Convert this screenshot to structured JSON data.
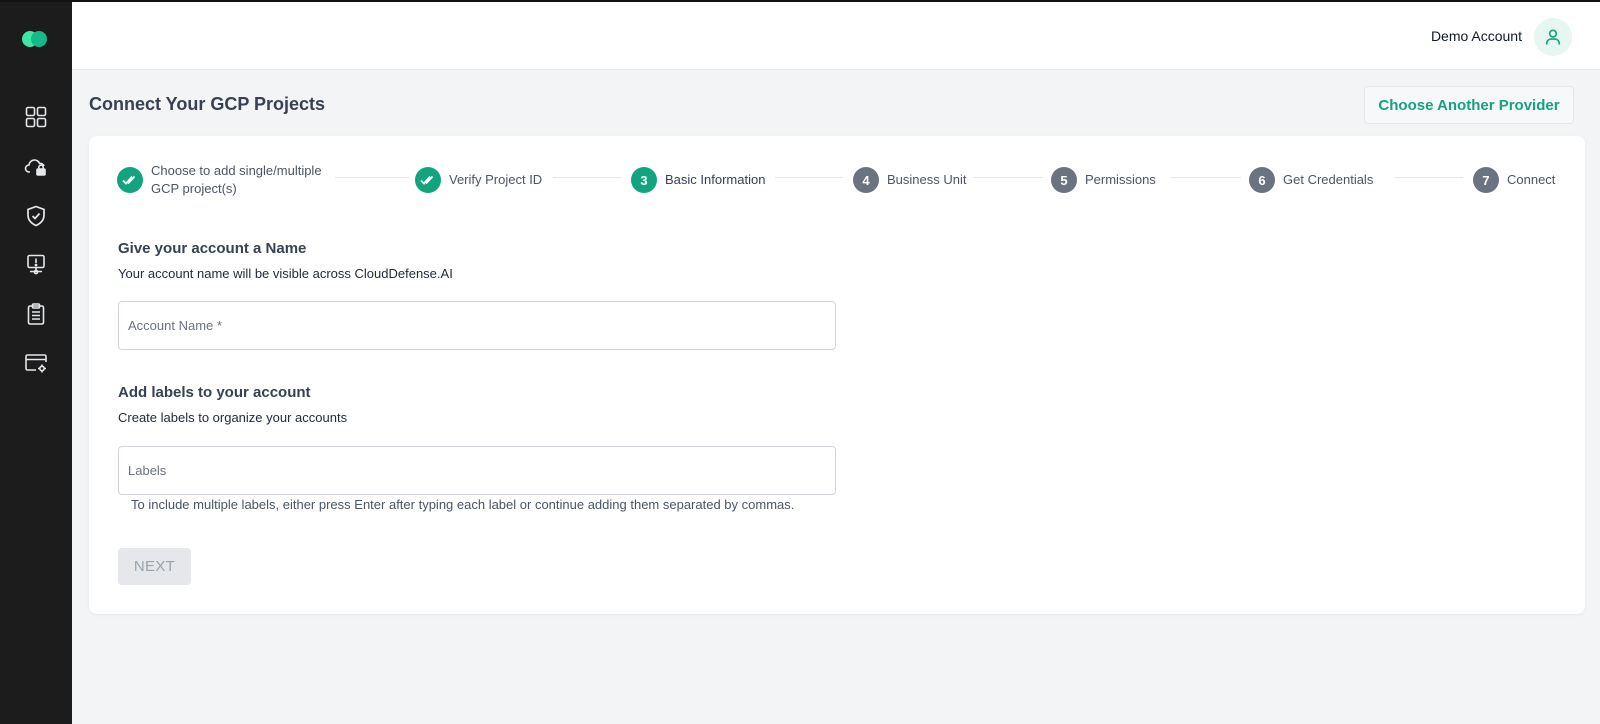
{
  "header": {
    "account_name": "Demo Account"
  },
  "sidebar": {
    "items": [
      {
        "icon": "dashboard-icon"
      },
      {
        "icon": "cloud-lock-icon"
      },
      {
        "icon": "shield-check-icon"
      },
      {
        "icon": "alert-monitor-icon"
      },
      {
        "icon": "clipboard-list-icon"
      },
      {
        "icon": "window-settings-icon"
      }
    ]
  },
  "page": {
    "title": "Connect Your GCP Projects",
    "choose_provider_label": "Choose Another Provider"
  },
  "stepper": {
    "steps": [
      {
        "number": "",
        "label": "Choose to add single/multiple GCP project(s)",
        "state": "done"
      },
      {
        "number": "",
        "label": "Verify Project ID",
        "state": "done"
      },
      {
        "number": "3",
        "label": "Basic Information",
        "state": "active"
      },
      {
        "number": "4",
        "label": "Business Unit",
        "state": "pending"
      },
      {
        "number": "5",
        "label": "Permissions",
        "state": "pending"
      },
      {
        "number": "6",
        "label": "Get Credentials",
        "state": "pending"
      },
      {
        "number": "7",
        "label": "Connect",
        "state": "pending"
      }
    ]
  },
  "account_section": {
    "title": "Give your account a Name",
    "subtitle": "Your account name will be visible across CloudDefense.AI",
    "placeholder": "Account Name *",
    "value": ""
  },
  "labels_section": {
    "title": "Add labels to your account",
    "subtitle": "Create labels to organize your accounts",
    "placeholder": "Labels",
    "value": "",
    "helper": "To include multiple labels, either press Enter after typing each label or continue adding them separated by commas."
  },
  "actions": {
    "next_label": "NEXT",
    "next_disabled": true
  },
  "colors": {
    "accent": "#14a37f",
    "sidebar_bg": "#1c1c1c",
    "pending_step": "#6b7280",
    "page_bg": "#f3f4f6"
  }
}
